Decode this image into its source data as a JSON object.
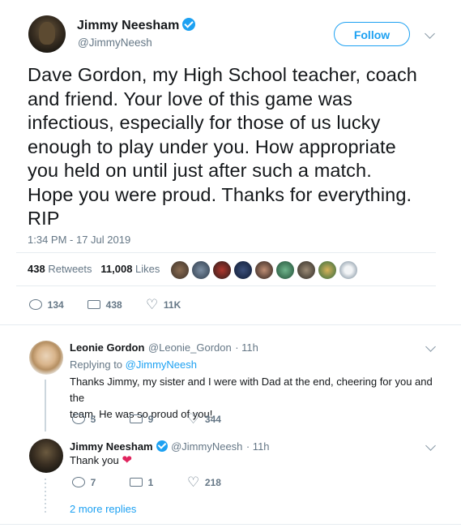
{
  "tweet": {
    "author_name": "Jimmy Neesham",
    "author_handle": "@JimmyNeesh",
    "follow_label": "Follow",
    "text_lines": [
      "Dave Gordon, my High School teacher, coach",
      "and friend. Your love of this game was",
      "infectious, especially for those of us lucky",
      "enough to play under you. How appropriate",
      "you held on until just after such a match.",
      "Hope you were proud. Thanks for everything.",
      "RIP"
    ],
    "timestamp": "1:34 PM - 17 Jul 2019",
    "retweets_count": "438",
    "retweets_label": "Retweets",
    "likes_count": "11,008",
    "likes_label": "Likes",
    "actions": {
      "replies": "134",
      "retweets": "438",
      "likes": "11K"
    }
  },
  "replies": [
    {
      "name": "Leonie Gordon",
      "handle": "@Leonie_Gordon",
      "time": "· 11h",
      "replying_prefix": "Replying to",
      "replying_handle": "@JimmyNeesh",
      "text_lines": [
        "Thanks Jimmy, my sister and I were with Dad at the end, cheering for you and the",
        "team. He was so proud of you!"
      ],
      "actions": {
        "replies": "5",
        "retweets": "9",
        "likes": "344"
      }
    },
    {
      "name": "Jimmy Neesham",
      "handle": "@JimmyNeesh",
      "time": "· 11h",
      "text": "Thank you",
      "actions": {
        "replies": "7",
        "retweets": "1",
        "likes": "218"
      }
    }
  ],
  "more_replies": "2 more replies",
  "colors": {
    "twitter_blue": "#1da1f2",
    "secondary_text": "#657786",
    "like_heart": "#e0245e"
  },
  "icons": [
    "verified-icon",
    "chevron-down-icon",
    "reply-icon",
    "retweet-icon",
    "heart-icon"
  ]
}
